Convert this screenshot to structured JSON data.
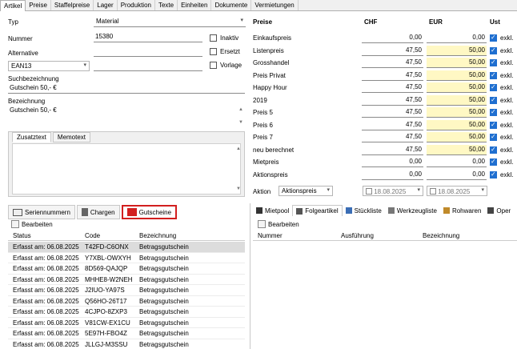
{
  "tabs": [
    "Artikel",
    "Preise",
    "Staffelpreise",
    "Lager",
    "Produktion",
    "Texte",
    "Einheiten",
    "Dokumente",
    "Vermietungen"
  ],
  "left": {
    "typ_label": "Typ",
    "typ_value": "Material",
    "nummer_label": "Nummer",
    "nummer_value": "15380",
    "alternative_label": "Alternative",
    "ean_select": "EAN13",
    "inaktiv": "Inaktiv",
    "ersetzt": "Ersetzt",
    "vorlage": "Vorlage",
    "suchbezeichnung_label": "Suchbezeichnung",
    "suchbezeichnung_value": "Gutschein 50,- €",
    "bezeichnung_label": "Bezeichnung",
    "bezeichnung_value": "Gutschein 50,- €",
    "text_tabs": [
      "Zusatztext",
      "Memotext"
    ]
  },
  "prices": {
    "header_preise": "Preise",
    "header_chf": "CHF",
    "header_eur": "EUR",
    "header_ust": "Ust",
    "rows": [
      {
        "label": "Einkaufspreis",
        "chf": "0,00",
        "eur": "0,00",
        "yellow": false,
        "ust": "exkl."
      },
      {
        "label": "Listenpreis",
        "chf": "47,50",
        "eur": "50,00",
        "yellow": true,
        "ust": "exkl."
      },
      {
        "label": "Grosshandel",
        "chf": "47,50",
        "eur": "50,00",
        "yellow": true,
        "ust": "exkl."
      },
      {
        "label": "Preis Privat",
        "chf": "47,50",
        "eur": "50,00",
        "yellow": true,
        "ust": "exkl."
      },
      {
        "label": "Happy Hour",
        "chf": "47,50",
        "eur": "50,00",
        "yellow": true,
        "ust": "exkl."
      },
      {
        "label": "2019",
        "chf": "47,50",
        "eur": "50,00",
        "yellow": true,
        "ust": "exkl."
      },
      {
        "label": "Preis 5",
        "chf": "47,50",
        "eur": "50,00",
        "yellow": true,
        "ust": "exkl."
      },
      {
        "label": "Preis 6",
        "chf": "47,50",
        "eur": "50,00",
        "yellow": true,
        "ust": "exkl."
      },
      {
        "label": "Preis 7",
        "chf": "47,50",
        "eur": "50,00",
        "yellow": true,
        "ust": "exkl."
      },
      {
        "label": "neu berechnet",
        "chf": "47,50",
        "eur": "50,00",
        "yellow": true,
        "ust": "exkl."
      },
      {
        "label": "Mietpreis",
        "chf": "0,00",
        "eur": "0,00",
        "yellow": false,
        "ust": "exkl."
      },
      {
        "label": "Aktionspreis",
        "chf": "0,00",
        "eur": "0,00",
        "yellow": false,
        "ust": "exkl."
      }
    ],
    "aktion_label": "Aktion",
    "aktion_select": "Aktionspreis",
    "date1": "18.08.2025",
    "date2": "18.08.2025"
  },
  "bottom_left": {
    "tabs": [
      "Seriennummern",
      "Chargen",
      "Gutscheine"
    ],
    "edit": "Bearbeiten",
    "columns": [
      "Status",
      "Code",
      "Bezeichnung"
    ],
    "rows": [
      {
        "status": "Erfasst am: 06.08.2025",
        "code": "T42FD-C6ONX",
        "bez": "Betragsgutschein"
      },
      {
        "status": "Erfasst am: 06.08.2025",
        "code": "Y7XBL-OWXYH",
        "bez": "Betragsgutschein"
      },
      {
        "status": "Erfasst am: 06.08.2025",
        "code": "8D569-QAJQP",
        "bez": "Betragsgutschein"
      },
      {
        "status": "Erfasst am: 06.08.2025",
        "code": "MHHE8-W2NEH",
        "bez": "Betragsgutschein"
      },
      {
        "status": "Erfasst am: 06.08.2025",
        "code": "J2IUO-YA97S",
        "bez": "Betragsgutschein"
      },
      {
        "status": "Erfasst am: 06.08.2025",
        "code": "Q56HO-26T17",
        "bez": "Betragsgutschein"
      },
      {
        "status": "Erfasst am: 06.08.2025",
        "code": "4CJPO-8ZXP3",
        "bez": "Betragsgutschein"
      },
      {
        "status": "Erfasst am: 06.08.2025",
        "code": "V81CW-EX1CU",
        "bez": "Betragsgutschein"
      },
      {
        "status": "Erfasst am: 06.08.2025",
        "code": "5E97H-FBO4Z",
        "bez": "Betragsgutschein"
      },
      {
        "status": "Erfasst am: 06.08.2025",
        "code": "JLLGJ-M3SSU",
        "bez": "Betragsgutschein"
      }
    ]
  },
  "bottom_right": {
    "tabs": [
      "Mietpool",
      "Folgeartikel",
      "Stückliste",
      "Werkzeugliste",
      "Rohwaren",
      "Oper"
    ],
    "edit": "Bearbeiten",
    "columns": [
      "Nummer",
      "Ausführung",
      "Bezeichnung"
    ]
  },
  "colors": {
    "accent": "#1f6fd0",
    "highlight_border": "#d21f1f",
    "yellow": "#fff8c4"
  }
}
